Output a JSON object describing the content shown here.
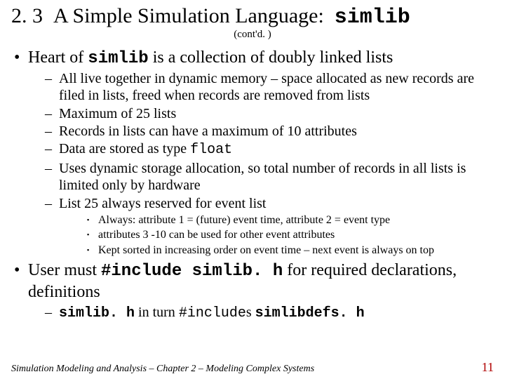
{
  "title": {
    "section_number": "2. 3",
    "text_before_code": "A Simple Simulation Language:",
    "code": "simlib",
    "contd": "(cont'd. )"
  },
  "bullet1": {
    "pre": "Heart of ",
    "code": "simlib",
    "post": " is a collection of doubly linked lists"
  },
  "sub": {
    "a": "All live together in dynamic memory – space allocated as new records are filed in lists, freed when records are removed from lists",
    "b": "Maximum of 25 lists",
    "c": "Records in lists can have a maximum of 10 attributes",
    "d_pre": "Data are stored as type ",
    "d_code": "float",
    "e": "Uses dynamic storage allocation, so total number of records in all lists is limited only by hardware",
    "f": "List 25 always reserved for event list"
  },
  "subsub": {
    "a": "Always:  attribute 1 = (future) event time, attribute 2 = event type",
    "b": "attributes 3 -10 can be used for other event attributes",
    "c": "Kept sorted in increasing order on event time – next event is always on top"
  },
  "bullet2": {
    "pre": "User must ",
    "code": "#include simlib. h",
    "post": "  for required declarations, definitions"
  },
  "sub2": {
    "code1": "simlib. h",
    "mid": " in turn ",
    "code2": "#include",
    "s": "s ",
    "code3": "simlibdefs. h"
  },
  "footer": {
    "text": "Simulation Modeling and Analysis – Chapter 2 – Modeling Complex Systems",
    "page": "11"
  }
}
